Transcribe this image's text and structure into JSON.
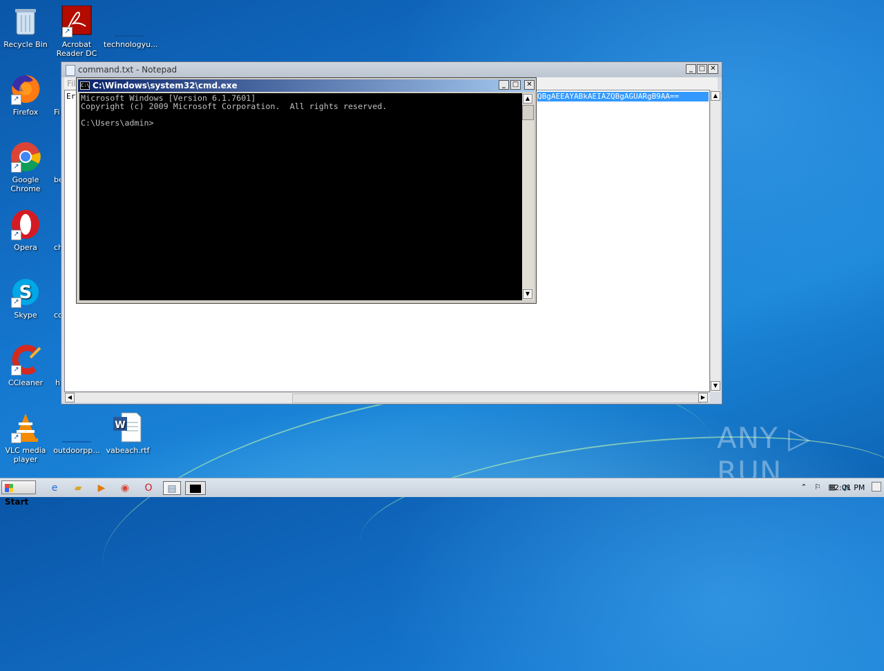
{
  "desktop": {
    "icons": {
      "recycle_bin": "Recycle Bin",
      "acrobat": "Acrobat Reader DC",
      "technology": "technologyu...",
      "firefox": "Firefox",
      "chrome": "Google Chrome",
      "opera": "Opera",
      "skype": "Skype",
      "ccleaner": "CCleaner",
      "vlc": "VLC media player",
      "outdoor": "outdoorpp...",
      "vabeach": "vabeach.rtf"
    },
    "partial_labels": [
      "Fi",
      "be",
      "ch",
      "cc",
      "h"
    ]
  },
  "notepad": {
    "title": "command.txt - Notepad",
    "menu_partial": "Fil",
    "line_start": "Er",
    "selected_text": "QBgAEEAYABkAEIAZQBgAGUARgB9AA=="
  },
  "cmd": {
    "title": "C:\\Windows\\system32\\cmd.exe",
    "icon_text": "C:\\",
    "output": "Microsoft Windows [Version 6.1.7601]\nCopyright (c) 2009 Microsoft Corporation.  All rights reserved.\n\nC:\\Users\\admin>"
  },
  "taskbar": {
    "start_label": "Start",
    "clock": "2:01 PM"
  },
  "watermark": "ANY ▷ RUN"
}
